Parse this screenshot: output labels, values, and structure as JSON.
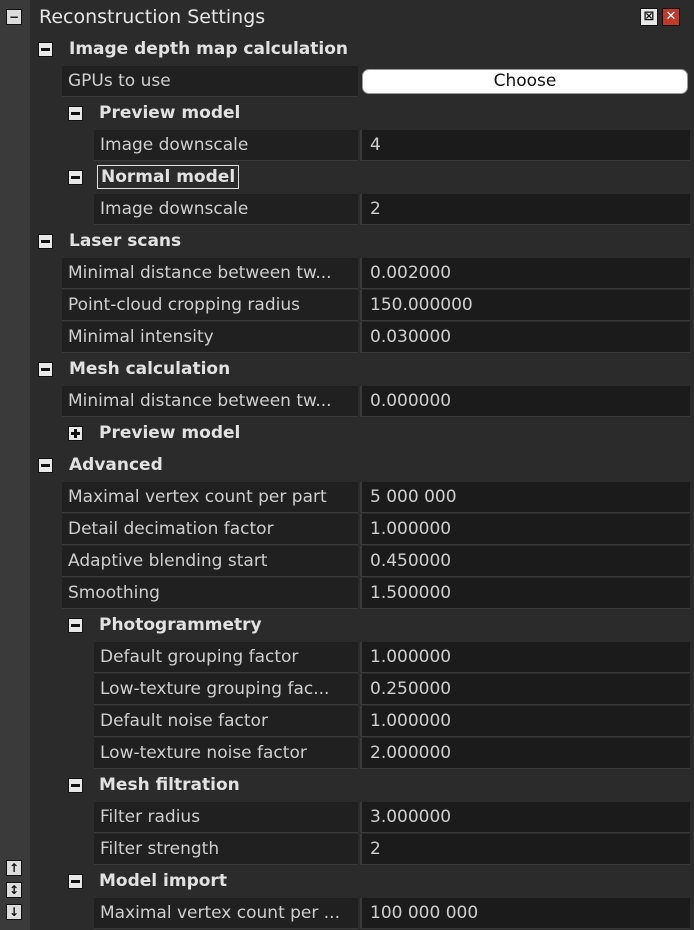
{
  "window": {
    "title": "Reconstruction Settings",
    "float_icon": "restore-float-icon",
    "close_icon": "close-icon"
  },
  "strip": {
    "collapse_icon": "minus-icon",
    "icons": [
      "dock-icon",
      "dock-icon",
      "dock-icon"
    ]
  },
  "rows": [
    {
      "type": "group",
      "level": 0,
      "expanded": true,
      "label": "Image depth map calculation"
    },
    {
      "type": "button",
      "level": 0,
      "label": "GPUs to use",
      "value": "Choose"
    },
    {
      "type": "group",
      "level": 1,
      "expanded": true,
      "label": "Preview model"
    },
    {
      "type": "prop",
      "level": 1,
      "label": "Image downscale",
      "value": "4"
    },
    {
      "type": "group",
      "level": 1,
      "expanded": true,
      "focused": true,
      "label": "Normal model"
    },
    {
      "type": "prop",
      "level": 1,
      "label": "Image downscale",
      "value": "2"
    },
    {
      "type": "group",
      "level": 0,
      "expanded": true,
      "label": "Laser scans"
    },
    {
      "type": "prop",
      "level": 0,
      "label": "Minimal distance between tw...",
      "value": "0.002000"
    },
    {
      "type": "prop",
      "level": 0,
      "label": "Point-cloud cropping radius",
      "value": "150.000000"
    },
    {
      "type": "prop",
      "level": 0,
      "label": "Minimal intensity",
      "value": "0.030000"
    },
    {
      "type": "group",
      "level": 0,
      "expanded": true,
      "label": "Mesh calculation"
    },
    {
      "type": "prop",
      "level": 0,
      "label": "Minimal distance between tw...",
      "value": "0.000000"
    },
    {
      "type": "group",
      "level": 1,
      "expanded": false,
      "label": "Preview model"
    },
    {
      "type": "group",
      "level": 0,
      "expanded": true,
      "label": "Advanced"
    },
    {
      "type": "prop",
      "level": 0,
      "label": "Maximal vertex count per part",
      "value": "5 000 000"
    },
    {
      "type": "prop",
      "level": 0,
      "label": "Detail decimation factor",
      "value": "1.000000"
    },
    {
      "type": "prop",
      "level": 0,
      "label": "Adaptive blending start",
      "value": "0.450000"
    },
    {
      "type": "prop",
      "level": 0,
      "label": "Smoothing",
      "value": "1.500000"
    },
    {
      "type": "group",
      "level": 1,
      "expanded": true,
      "label": "Photogrammetry"
    },
    {
      "type": "prop",
      "level": 1,
      "label": "Default grouping factor",
      "value": "1.000000"
    },
    {
      "type": "prop",
      "level": 1,
      "label": "Low-texture grouping fac...",
      "value": "0.250000"
    },
    {
      "type": "prop",
      "level": 1,
      "label": "Default noise factor",
      "value": "1.000000"
    },
    {
      "type": "prop",
      "level": 1,
      "label": "Low-texture noise factor",
      "value": "2.000000"
    },
    {
      "type": "group",
      "level": 1,
      "expanded": true,
      "label": "Mesh filtration"
    },
    {
      "type": "prop",
      "level": 1,
      "label": "Filter radius",
      "value": "3.000000"
    },
    {
      "type": "prop",
      "level": 1,
      "label": "Filter strength",
      "value": "2"
    },
    {
      "type": "group",
      "level": 1,
      "expanded": true,
      "label": "Model import"
    },
    {
      "type": "prop",
      "level": 1,
      "label": "Maximal vertex count per ...",
      "value": "100 000 000"
    }
  ]
}
